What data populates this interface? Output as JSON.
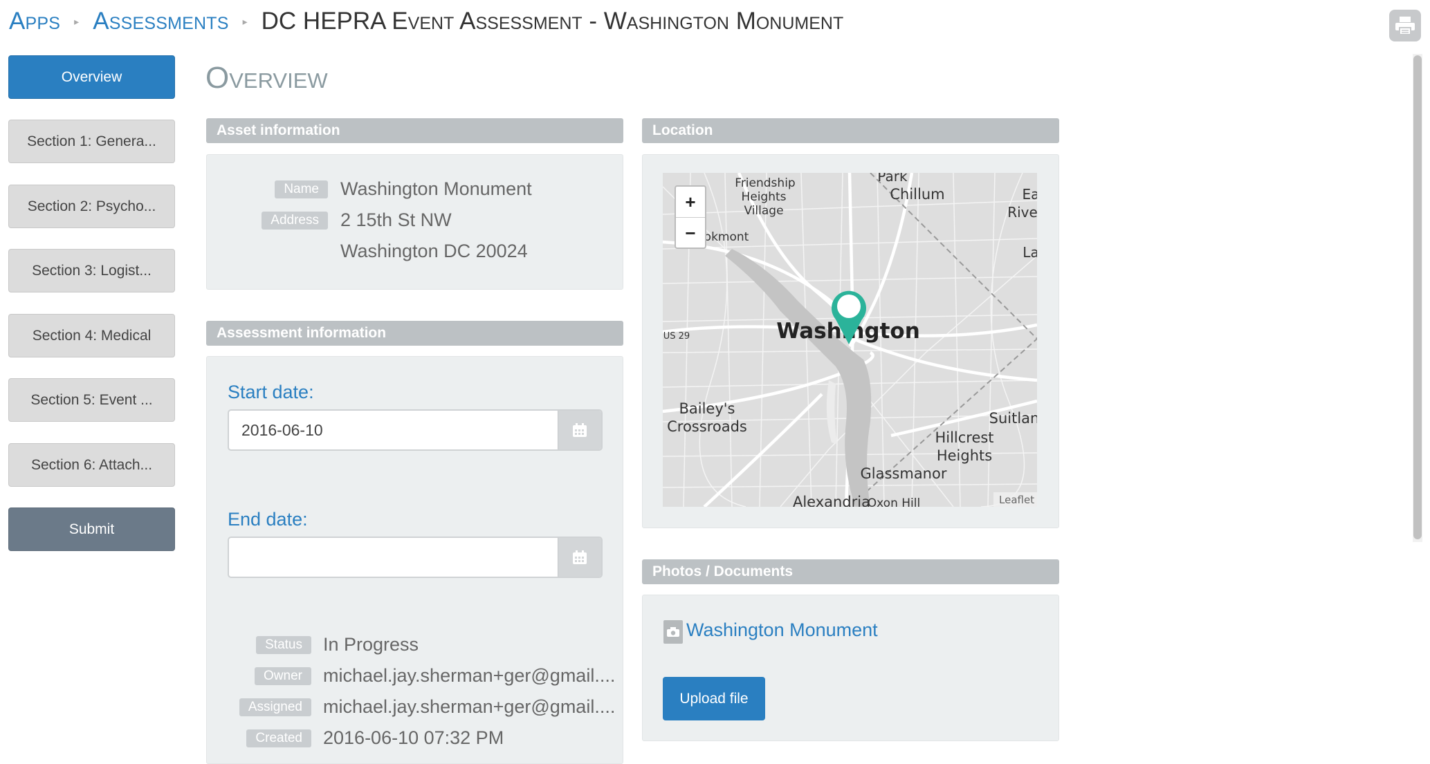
{
  "breadcrumb": {
    "apps": "Apps",
    "assessments": "Assessments",
    "current": "DC HEPRA Event Assessment - Washington Monument"
  },
  "sidebar": {
    "items": [
      {
        "label": "Overview"
      },
      {
        "label": "Section 1: Genera..."
      },
      {
        "label": "Section 2: Psycho..."
      },
      {
        "label": "Section 3: Logist..."
      },
      {
        "label": "Section 4: Medical"
      },
      {
        "label": "Section 5: Event ..."
      },
      {
        "label": "Section 6: Attach..."
      }
    ],
    "submit": "Submit"
  },
  "main": {
    "title": "Overview",
    "asset": {
      "header": "Asset information",
      "name_label": "Name",
      "name": "Washington Monument",
      "address_label": "Address",
      "address_line1": "2 15th St NW",
      "address_line2": "Washington DC  20024"
    },
    "assessment": {
      "header": "Assessment information",
      "start_label": "Start date:",
      "start_value": "2016-06-10",
      "end_label": "End date:",
      "end_value": "",
      "status_label": "Status",
      "status": "In Progress",
      "owner_label": "Owner",
      "owner": "michael.jay.sherman+ger@gmail....",
      "assigned_label": "Assigned",
      "assigned": "michael.jay.sherman+ger@gmail....",
      "created_label": "Created",
      "created": "2016-06-10 07:32 PM"
    },
    "location": {
      "header": "Location",
      "zoom_in": "+",
      "zoom_out": "−",
      "attribution": "Leaflet",
      "places": [
        "Friendship",
        "Heights",
        "Village",
        "Park",
        "Chillum",
        "Ea",
        "Rive",
        "La",
        "okmont",
        "Washington",
        "US 29",
        "Bailey's",
        "Crossroads",
        "Suitlan",
        "Hillcrest",
        "Heights",
        "Glassmanor",
        "Alexandria",
        "Oxon Hill"
      ]
    },
    "photos": {
      "header": "Photos / Documents",
      "file": "Washington Monument",
      "upload": "Upload file"
    }
  },
  "colors": {
    "accent": "#2a7fc1",
    "submit": "#6b7a89",
    "panel_header": "#bcc1c4",
    "marker": "#2bb39a"
  },
  "icons": [
    "print-icon",
    "calendar-icon",
    "photo-icon",
    "map-marker-icon"
  ]
}
